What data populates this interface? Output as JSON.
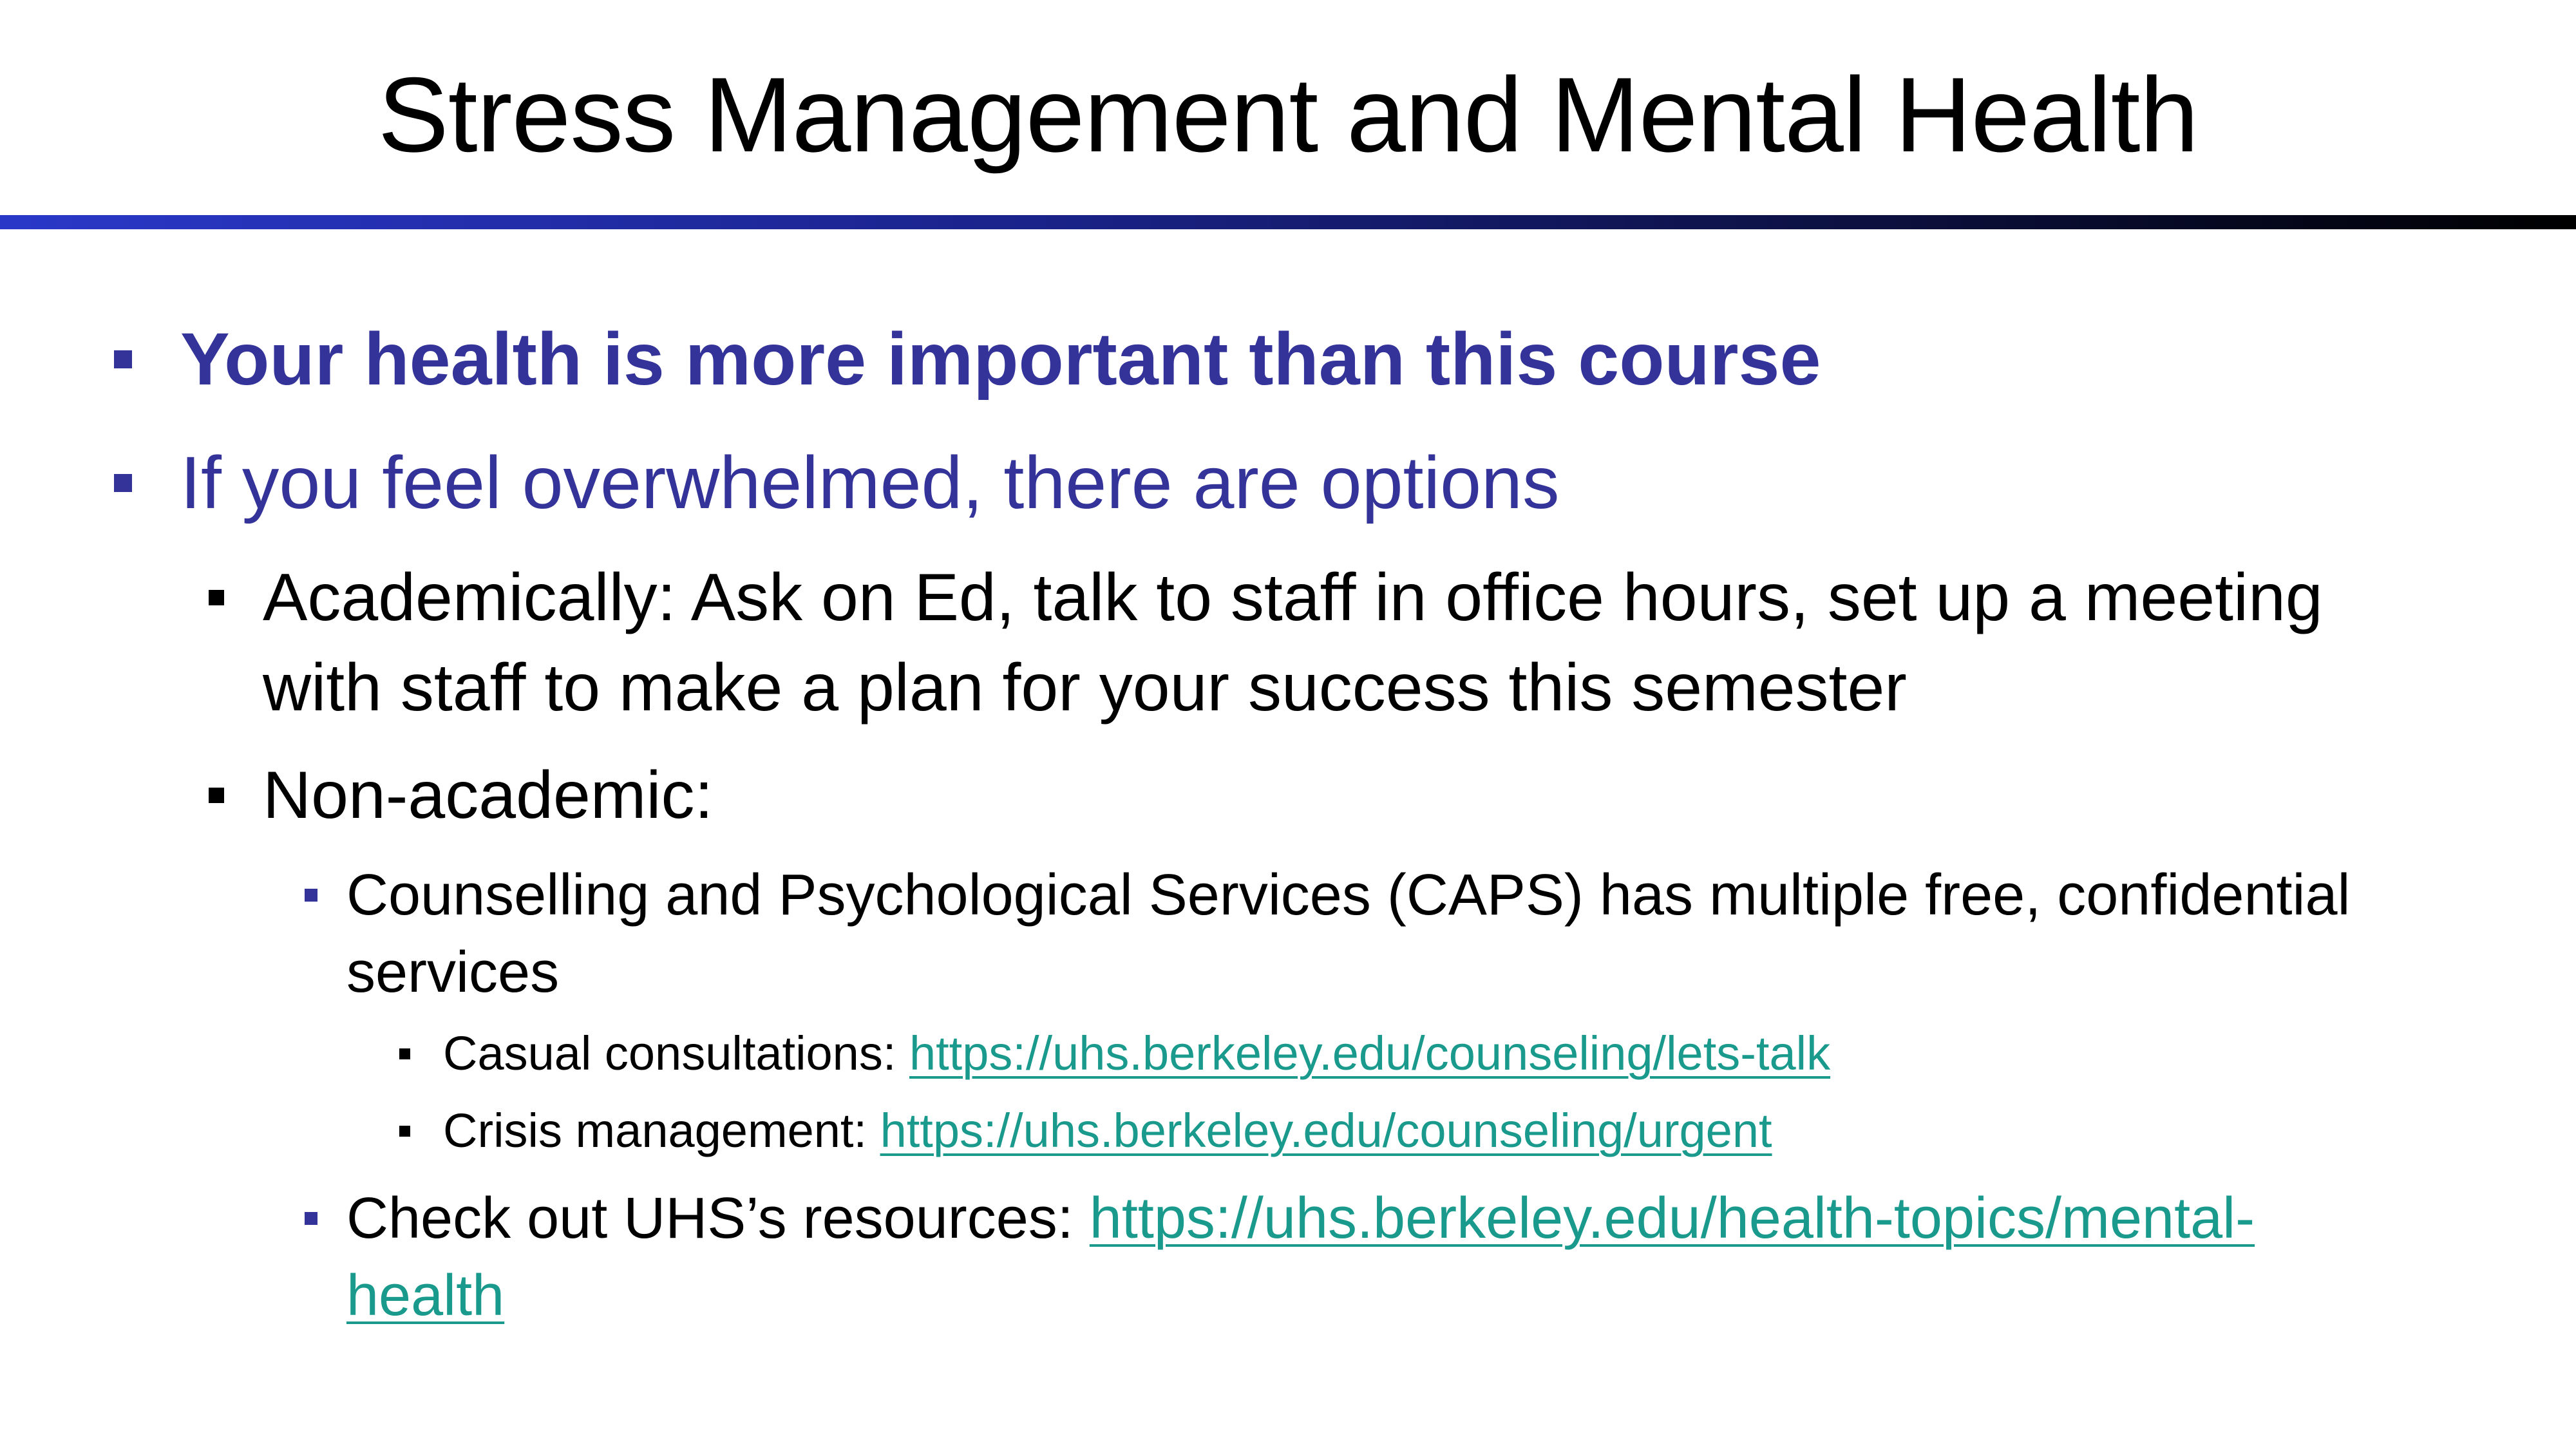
{
  "slide": {
    "title": "Stress Management and Mental Health",
    "colors": {
      "accent_blue": "#333399",
      "link_teal": "#1a9a8c",
      "rule_start": "#2a38c8",
      "rule_end": "#000000"
    },
    "bullets": {
      "health": "Your health is more important than this course",
      "overwhelmed": "If you feel overwhelmed, there are options",
      "academic_line1": "Academically: Ask on Ed, talk to staff in office hours, set up a meeting",
      "academic_line2": "with staff to make a plan for your success this semester",
      "nonacademic": "Non-academic:",
      "caps_line1": "Counselling and Psychological Services (CAPS) has multiple free, confidential",
      "caps_line2": "services",
      "casual_label": "Casual consultations: ",
      "casual_link": "https://uhs.berkeley.edu/counseling/lets-talk",
      "crisis_label": "Crisis management: ",
      "crisis_link": "https://uhs.berkeley.edu/counseling/urgent",
      "uhs_label": "Check out UHS’s resources: ",
      "uhs_link_line1": "https://uhs.berkeley.edu/health-topics/mental-",
      "uhs_link_line2": "health"
    }
  }
}
